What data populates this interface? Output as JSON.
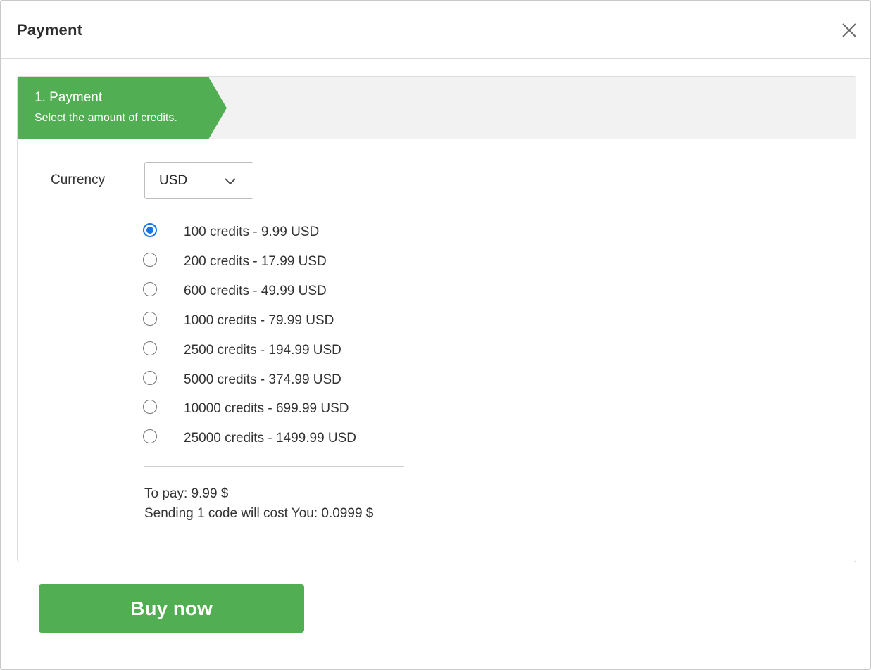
{
  "modal": {
    "title": "Payment",
    "close_icon": "close-icon"
  },
  "steps": {
    "active": {
      "title": "1. Payment",
      "subtitle": "Select the amount of credits."
    }
  },
  "currency": {
    "label": "Currency",
    "selected": "USD",
    "icon": "chevron-down-icon"
  },
  "packages": [
    {
      "label": "100 credits - 9.99 USD",
      "checked": true
    },
    {
      "label": "200 credits - 17.99 USD",
      "checked": false
    },
    {
      "label": "600 credits - 49.99 USD",
      "checked": false
    },
    {
      "label": "1000 credits - 79.99 USD",
      "checked": false
    },
    {
      "label": "2500 credits - 194.99 USD",
      "checked": false
    },
    {
      "label": "5000 credits - 374.99 USD",
      "checked": false
    },
    {
      "label": "10000 credits - 699.99 USD",
      "checked": false
    },
    {
      "label": "25000 credits - 1499.99 USD",
      "checked": false
    }
  ],
  "summary": {
    "to_pay": "To pay: 9.99 $",
    "code_cost": "Sending 1 code will cost You: 0.0999 $"
  },
  "actions": {
    "buy_label": "Buy now"
  },
  "colors": {
    "accent_green": "#52ae52",
    "radio_blue": "#1a73e8"
  }
}
